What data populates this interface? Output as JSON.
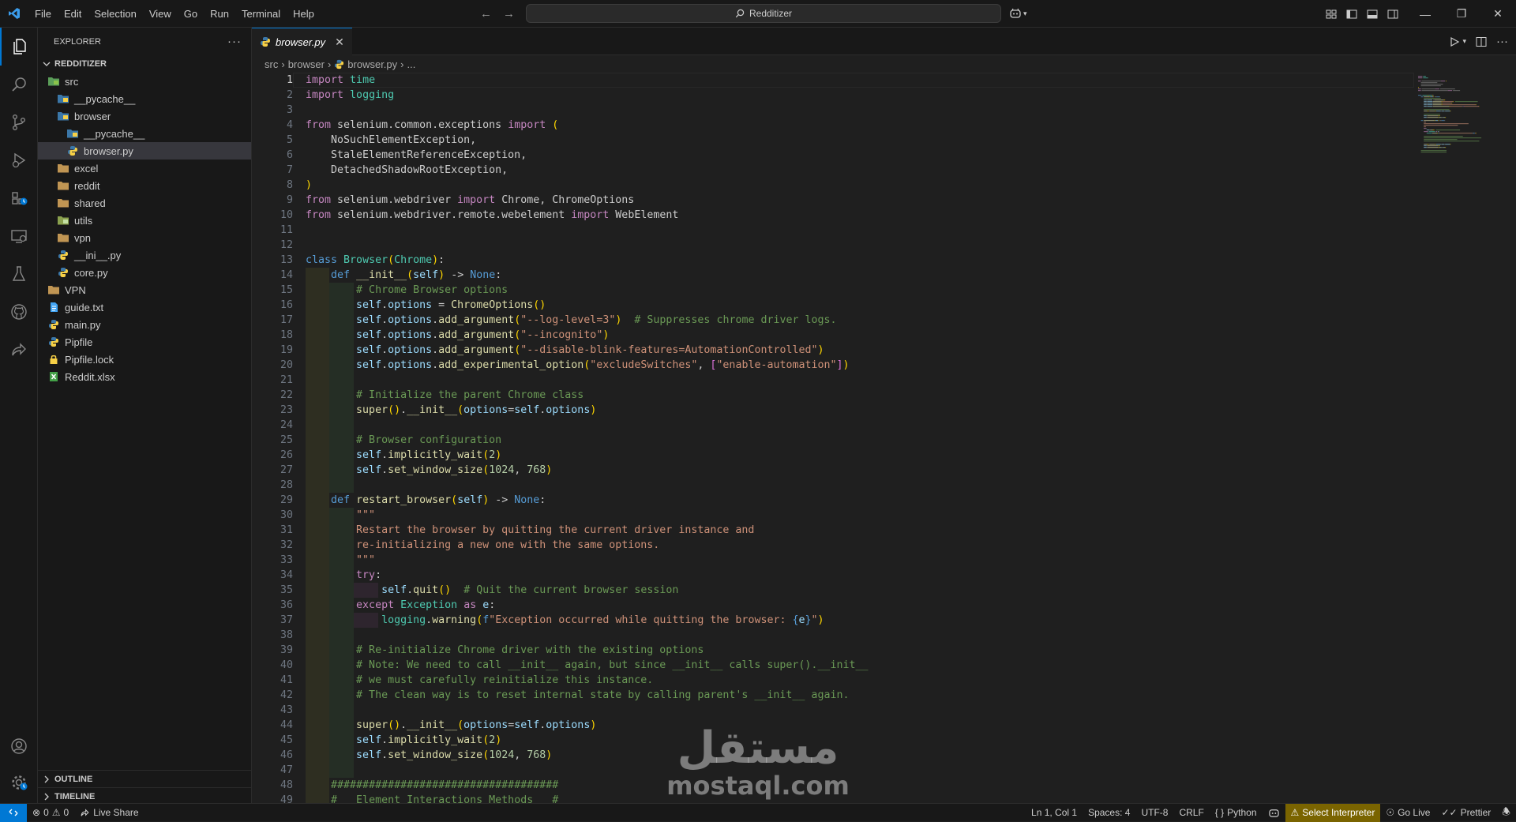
{
  "titlebar": {
    "menu": [
      "File",
      "Edit",
      "Selection",
      "View",
      "Go",
      "Run",
      "Terminal",
      "Help"
    ],
    "search_text": "Redditizer"
  },
  "sidebar": {
    "title": "EXPLORER",
    "project": "REDDITIZER",
    "tree": [
      {
        "label": "src",
        "kind": "folder-src"
      },
      {
        "label": "__pycache__",
        "kind": "folder-blue"
      },
      {
        "label": "browser",
        "kind": "folder-blue"
      },
      {
        "label": "__pycache__",
        "kind": "folder-blue"
      },
      {
        "label": "browser.py",
        "kind": "python"
      },
      {
        "label": "excel",
        "kind": "folder"
      },
      {
        "label": "reddit",
        "kind": "folder"
      },
      {
        "label": "shared",
        "kind": "folder"
      },
      {
        "label": "utils",
        "kind": "folder-green"
      },
      {
        "label": "vpn",
        "kind": "folder"
      },
      {
        "label": "__ini__.py",
        "kind": "python"
      },
      {
        "label": "core.py",
        "kind": "python"
      },
      {
        "label": "VPN",
        "kind": "folder"
      },
      {
        "label": "guide.txt",
        "kind": "text"
      },
      {
        "label": "main.py",
        "kind": "python"
      },
      {
        "label": "Pipfile",
        "kind": "python"
      },
      {
        "label": "Pipfile.lock",
        "kind": "lock"
      },
      {
        "label": "Reddit.xlsx",
        "kind": "excel"
      }
    ],
    "outline": "OUTLINE",
    "timeline": "TIMELINE"
  },
  "editor": {
    "tab_label": "browser.py",
    "breadcrumb": [
      "src",
      "browser",
      "browser.py",
      "..."
    ],
    "active_line": 1
  },
  "statusbar": {
    "problems": "0",
    "warnings": "0",
    "live_share": "Live Share",
    "position": "Ln 1, Col 1",
    "spaces": "Spaces: 4",
    "encoding": "UTF-8",
    "eol": "CRLF",
    "language": "Python",
    "interpreter": "Select Interpreter",
    "go_live": "Go Live",
    "prettier": "Prettier"
  },
  "watermark": {
    "arabic": "مستقل",
    "latin": "mostaql.com"
  },
  "code": [
    [
      [
        "import",
        "kc"
      ],
      [
        " time",
        "cl"
      ]
    ],
    [
      [
        "import",
        "kc"
      ],
      [
        " logging",
        "cl"
      ]
    ],
    [],
    [
      [
        "from",
        "kc"
      ],
      [
        " selenium.common.exceptions ",
        ""
      ],
      [
        "import",
        "kc"
      ],
      [
        " ",
        ""
      ],
      [
        "(",
        "p1"
      ]
    ],
    [
      [
        "    NoSuchElementException,",
        ""
      ]
    ],
    [
      [
        "    StaleElementReferenceException,",
        ""
      ]
    ],
    [
      [
        "    DetachedShadowRootException,",
        ""
      ]
    ],
    [
      [
        ")",
        "p1"
      ]
    ],
    [
      [
        "from",
        "kc"
      ],
      [
        " selenium.webdriver ",
        ""
      ],
      [
        "import",
        "kc"
      ],
      [
        " Chrome, ChromeOptions",
        ""
      ]
    ],
    [
      [
        "from",
        "kc"
      ],
      [
        " selenium.webdriver.remote.webelement ",
        ""
      ],
      [
        "import",
        "kc"
      ],
      [
        " WebElement",
        ""
      ]
    ],
    [],
    [],
    [
      [
        "class",
        "kw"
      ],
      [
        " ",
        ""
      ],
      [
        "Browser",
        "cl"
      ],
      [
        "(",
        "p1"
      ],
      [
        "Chrome",
        "cl"
      ],
      [
        ")",
        "p1"
      ],
      [
        ":",
        ""
      ]
    ],
    [
      [
        "    ",
        ""
      ],
      [
        "def",
        "kw"
      ],
      [
        " ",
        ""
      ],
      [
        "__init__",
        "fn"
      ],
      [
        "(",
        "p1"
      ],
      [
        "self",
        "se"
      ],
      [
        ")",
        "p1"
      ],
      [
        " -> ",
        ""
      ],
      [
        "None",
        "kw"
      ],
      [
        ":",
        ""
      ]
    ],
    [
      [
        "        ",
        ""
      ],
      [
        "# Chrome Browser options",
        "cm"
      ]
    ],
    [
      [
        "        ",
        ""
      ],
      [
        "self",
        "se"
      ],
      [
        ".",
        ""
      ],
      [
        "options",
        "se"
      ],
      [
        " = ",
        ""
      ],
      [
        "ChromeOptions",
        "fn"
      ],
      [
        "()",
        "p1"
      ]
    ],
    [
      [
        "        ",
        ""
      ],
      [
        "self",
        "se"
      ],
      [
        ".",
        ""
      ],
      [
        "options",
        "se"
      ],
      [
        ".",
        ""
      ],
      [
        "add_argument",
        "fn"
      ],
      [
        "(",
        "p1"
      ],
      [
        "\"--log-level=3\"",
        "st"
      ],
      [
        ")",
        "p1"
      ],
      [
        "  ",
        ""
      ],
      [
        "# Suppresses chrome driver logs.",
        "cm"
      ]
    ],
    [
      [
        "        ",
        ""
      ],
      [
        "self",
        "se"
      ],
      [
        ".",
        ""
      ],
      [
        "options",
        "se"
      ],
      [
        ".",
        ""
      ],
      [
        "add_argument",
        "fn"
      ],
      [
        "(",
        "p1"
      ],
      [
        "\"--incognito\"",
        "st"
      ],
      [
        ")",
        "p1"
      ]
    ],
    [
      [
        "        ",
        ""
      ],
      [
        "self",
        "se"
      ],
      [
        ".",
        ""
      ],
      [
        "options",
        "se"
      ],
      [
        ".",
        ""
      ],
      [
        "add_argument",
        "fn"
      ],
      [
        "(",
        "p1"
      ],
      [
        "\"--disable-blink-features=AutomationControlled\"",
        "st"
      ],
      [
        ")",
        "p1"
      ]
    ],
    [
      [
        "        ",
        ""
      ],
      [
        "self",
        "se"
      ],
      [
        ".",
        ""
      ],
      [
        "options",
        "se"
      ],
      [
        ".",
        ""
      ],
      [
        "add_experimental_option",
        "fn"
      ],
      [
        "(",
        "p1"
      ],
      [
        "\"excludeSwitches\"",
        "st"
      ],
      [
        ", ",
        ""
      ],
      [
        "[",
        "p2"
      ],
      [
        "\"enable-automation\"",
        "st"
      ],
      [
        "]",
        "p2"
      ],
      [
        ")",
        "p1"
      ]
    ],
    [],
    [
      [
        "        ",
        ""
      ],
      [
        "# Initialize the parent Chrome class",
        "cm"
      ]
    ],
    [
      [
        "        ",
        ""
      ],
      [
        "super",
        "fn"
      ],
      [
        "()",
        "p1"
      ],
      [
        ".",
        ""
      ],
      [
        "__init__",
        "fn"
      ],
      [
        "(",
        "p1"
      ],
      [
        "options",
        "se"
      ],
      [
        "=",
        ""
      ],
      [
        "self",
        "se"
      ],
      [
        ".",
        ""
      ],
      [
        "options",
        "se"
      ],
      [
        ")",
        "p1"
      ]
    ],
    [],
    [
      [
        "        ",
        ""
      ],
      [
        "# Browser configuration",
        "cm"
      ]
    ],
    [
      [
        "        ",
        ""
      ],
      [
        "self",
        "se"
      ],
      [
        ".",
        ""
      ],
      [
        "implicitly_wait",
        "fn"
      ],
      [
        "(",
        "p1"
      ],
      [
        "2",
        "nu"
      ],
      [
        ")",
        "p1"
      ]
    ],
    [
      [
        "        ",
        ""
      ],
      [
        "self",
        "se"
      ],
      [
        ".",
        ""
      ],
      [
        "set_window_size",
        "fn"
      ],
      [
        "(",
        "p1"
      ],
      [
        "1024",
        "nu"
      ],
      [
        ", ",
        ""
      ],
      [
        "768",
        "nu"
      ],
      [
        ")",
        "p1"
      ]
    ],
    [],
    [
      [
        "    ",
        ""
      ],
      [
        "def",
        "kw"
      ],
      [
        " ",
        ""
      ],
      [
        "restart_browser",
        "fn"
      ],
      [
        "(",
        "p1"
      ],
      [
        "self",
        "se"
      ],
      [
        ")",
        "p1"
      ],
      [
        " -> ",
        ""
      ],
      [
        "None",
        "kw"
      ],
      [
        ":",
        ""
      ]
    ],
    [
      [
        "        ",
        ""
      ],
      [
        "\"\"\"",
        "st"
      ]
    ],
    [
      [
        "        ",
        ""
      ],
      [
        "Restart the browser by quitting the current driver instance and",
        "st"
      ]
    ],
    [
      [
        "        ",
        ""
      ],
      [
        "re-initializing a new one with the same options.",
        "st"
      ]
    ],
    [
      [
        "        ",
        ""
      ],
      [
        "\"\"\"",
        "st"
      ]
    ],
    [
      [
        "        ",
        ""
      ],
      [
        "try",
        "kc"
      ],
      [
        ":",
        ""
      ]
    ],
    [
      [
        "            ",
        ""
      ],
      [
        "self",
        "se"
      ],
      [
        ".",
        ""
      ],
      [
        "quit",
        "fn"
      ],
      [
        "()",
        "p1"
      ],
      [
        "  ",
        ""
      ],
      [
        "# Quit the current browser session",
        "cm"
      ]
    ],
    [
      [
        "        ",
        ""
      ],
      [
        "except",
        "kc"
      ],
      [
        " ",
        ""
      ],
      [
        "Exception",
        "cl"
      ],
      [
        " ",
        ""
      ],
      [
        "as",
        "kc"
      ],
      [
        " ",
        ""
      ],
      [
        "e",
        "se"
      ],
      [
        ":",
        ""
      ]
    ],
    [
      [
        "            ",
        ""
      ],
      [
        "logging",
        "cl"
      ],
      [
        ".",
        ""
      ],
      [
        "warning",
        "fn"
      ],
      [
        "(",
        "p1"
      ],
      [
        "f",
        "kw"
      ],
      [
        "\"Exception occurred while quitting the browser: ",
        "st"
      ],
      [
        "{",
        "kw"
      ],
      [
        "e",
        "se"
      ],
      [
        "}",
        "kw"
      ],
      [
        "\"",
        "st"
      ],
      [
        ")",
        "p1"
      ]
    ],
    [],
    [
      [
        "        ",
        ""
      ],
      [
        "# Re-initialize Chrome driver with the existing options",
        "cm"
      ]
    ],
    [
      [
        "        ",
        ""
      ],
      [
        "# Note: We need to call __init__ again, but since __init__ calls super().__init__",
        "cm"
      ]
    ],
    [
      [
        "        ",
        ""
      ],
      [
        "# we must carefully reinitialize this instance.",
        "cm"
      ]
    ],
    [
      [
        "        ",
        ""
      ],
      [
        "# The clean way is to reset internal state by calling parent's __init__ again.",
        "cm"
      ]
    ],
    [],
    [
      [
        "        ",
        ""
      ],
      [
        "super",
        "fn"
      ],
      [
        "()",
        "p1"
      ],
      [
        ".",
        ""
      ],
      [
        "__init__",
        "fn"
      ],
      [
        "(",
        "p1"
      ],
      [
        "options",
        "se"
      ],
      [
        "=",
        ""
      ],
      [
        "self",
        "se"
      ],
      [
        ".",
        ""
      ],
      [
        "options",
        "se"
      ],
      [
        ")",
        "p1"
      ]
    ],
    [
      [
        "        ",
        ""
      ],
      [
        "self",
        "se"
      ],
      [
        ".",
        ""
      ],
      [
        "implicitly_wait",
        "fn"
      ],
      [
        "(",
        "p1"
      ],
      [
        "2",
        "nu"
      ],
      [
        ")",
        "p1"
      ]
    ],
    [
      [
        "        ",
        ""
      ],
      [
        "self",
        "se"
      ],
      [
        ".",
        ""
      ],
      [
        "set_window_size",
        "fn"
      ],
      [
        "(",
        "p1"
      ],
      [
        "1024",
        "nu"
      ],
      [
        ", ",
        ""
      ],
      [
        "768",
        "nu"
      ],
      [
        ")",
        "p1"
      ]
    ],
    [],
    [
      [
        "    ",
        ""
      ],
      [
        "####################################",
        "cm"
      ]
    ],
    [
      [
        "    ",
        ""
      ],
      [
        "#   Element Interactions Methods   #",
        "cm"
      ]
    ]
  ]
}
